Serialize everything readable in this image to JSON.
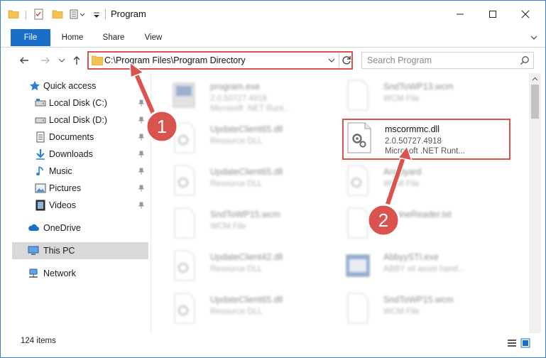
{
  "window": {
    "title": "Program",
    "accent_color": "#1a6dc9",
    "annotation_color": "#d9534f"
  },
  "ribbon": {
    "tabs": [
      {
        "label": "File",
        "active": true
      },
      {
        "label": "Home"
      },
      {
        "label": "Share"
      },
      {
        "label": "View"
      }
    ]
  },
  "address_bar": {
    "path": "C:\\Program Files\\Program Directory",
    "icon": "folder-icon"
  },
  "search": {
    "placeholder": "Search Program"
  },
  "sidebar": {
    "items": [
      {
        "label": "Quick access",
        "icon": "star-icon"
      },
      {
        "label": "Local Disk (C:)",
        "icon": "drive-icon",
        "pinned": true
      },
      {
        "label": "Local Disk (D:)",
        "icon": "drive-icon",
        "pinned": true
      },
      {
        "label": "Documents",
        "icon": "documents-icon",
        "pinned": true
      },
      {
        "label": "Downloads",
        "icon": "download-icon",
        "pinned": true
      },
      {
        "label": "Music",
        "icon": "music-icon",
        "pinned": true
      },
      {
        "label": "Pictures",
        "icon": "pictures-icon",
        "pinned": true
      },
      {
        "label": "Videos",
        "icon": "videos-icon",
        "pinned": true
      },
      {
        "label": "OneDrive",
        "icon": "cloud-icon"
      },
      {
        "label": "This PC",
        "icon": "computer-icon",
        "selected": true
      },
      {
        "label": "Network",
        "icon": "network-icon"
      }
    ]
  },
  "files": [
    {
      "name": "program.exe",
      "line2": "2.0.50727.4918",
      "line3": "Microsoft .NET Runt...",
      "icon": "exe-icon"
    },
    {
      "name": "SndToWP13.wcm",
      "line2": "WCM File",
      "line3": "",
      "icon": "blank-file-icon"
    },
    {
      "name": "UpdateClient65.dll",
      "line2": "Resource DLL",
      "line3": "",
      "icon": "dll-file-icon"
    },
    {
      "name": "mscormmc.dll",
      "line2": "2.0.50727.4918",
      "line3": "Microsoft .NET Runt...",
      "icon": "dll-file-icon",
      "highlighted": true
    },
    {
      "name": "UpdateClient65.dll",
      "line2": "Resource DLL",
      "line3": "",
      "icon": "dll-file-icon"
    },
    {
      "name": "Arabiyard",
      "line2": "WCM File",
      "line3": "",
      "icon": "dll-file-icon"
    },
    {
      "name": "SndToWP15.wcm",
      "line2": "WCM File",
      "line3": "",
      "icon": "blank-file-icon"
    },
    {
      "name": "EngineReader.txt",
      "line2": "Text",
      "line3": "",
      "icon": "blank-file-icon"
    },
    {
      "name": "UpdateClient42.dll",
      "line2": "Resource DLL",
      "line3": "",
      "icon": "dll-file-icon"
    },
    {
      "name": "AbbyySTI.exe",
      "line2": "ABBY sti asset hand...",
      "line3": "",
      "icon": "app-icon"
    },
    {
      "name": "UpdateClient65.dll",
      "line2": "Resource DLL",
      "line3": "",
      "icon": "dll-file-icon"
    },
    {
      "name": "SndToWP15.wcm",
      "line2": "WCM File",
      "line3": "",
      "icon": "blank-file-icon"
    }
  ],
  "status": {
    "item_count": "124 items"
  },
  "annotations": [
    {
      "number": "1",
      "target": "address-bar"
    },
    {
      "number": "2",
      "target": "mscormmc.dll"
    }
  ]
}
